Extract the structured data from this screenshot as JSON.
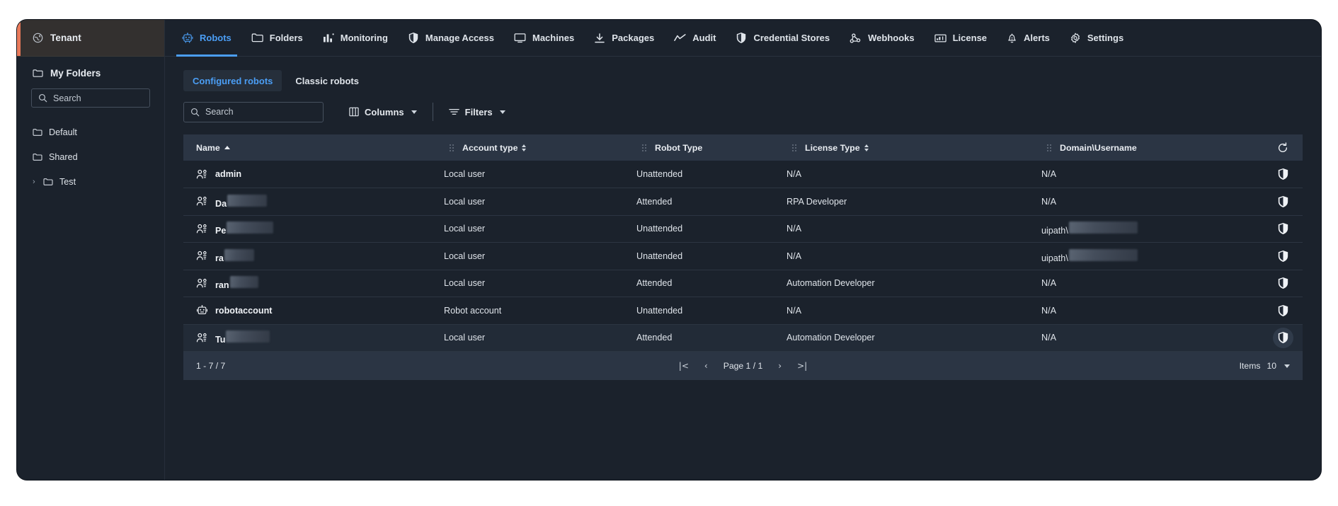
{
  "sidebar": {
    "tenant_label": "Tenant",
    "tenant_icon": "globe-icon",
    "my_folders_label": "My Folders",
    "search_placeholder": "Search",
    "folders": [
      {
        "label": "Default",
        "expandable": false
      },
      {
        "label": "Shared",
        "expandable": false
      },
      {
        "label": "Test",
        "expandable": true
      }
    ]
  },
  "topnav": {
    "tabs": [
      {
        "label": "Robots",
        "icon": "robot-icon",
        "active": true
      },
      {
        "label": "Folders",
        "icon": "folder-icon",
        "active": false
      },
      {
        "label": "Monitoring",
        "icon": "bar-chart-icon",
        "active": false
      },
      {
        "label": "Manage Access",
        "icon": "shield-icon",
        "active": false
      },
      {
        "label": "Machines",
        "icon": "monitor-icon",
        "active": false
      },
      {
        "label": "Packages",
        "icon": "download-icon",
        "active": false
      },
      {
        "label": "Audit",
        "icon": "trend-line-icon",
        "active": false
      },
      {
        "label": "Credential Stores",
        "icon": "shield-icon",
        "active": false
      },
      {
        "label": "Webhooks",
        "icon": "webhook-icon",
        "active": false
      },
      {
        "label": "License",
        "icon": "license-icon",
        "active": false
      },
      {
        "label": "Alerts",
        "icon": "bell-icon",
        "active": false
      },
      {
        "label": "Settings",
        "icon": "gear-icon",
        "active": false
      }
    ]
  },
  "subtabs": [
    {
      "label": "Configured robots",
      "active": true
    },
    {
      "label": "Classic robots",
      "active": false
    }
  ],
  "toolbar": {
    "search_placeholder": "Search",
    "columns_label": "Columns",
    "filters_label": "Filters",
    "columns_icon": "columns-icon",
    "filters_icon": "filter-icon"
  },
  "table": {
    "columns": [
      {
        "label": "Name",
        "sort": "asc",
        "draggable": false
      },
      {
        "label": "Account type",
        "sort": "both",
        "draggable": true
      },
      {
        "label": "Robot Type",
        "sort": "none",
        "draggable": true
      },
      {
        "label": "License Type",
        "sort": "both",
        "draggable": true
      },
      {
        "label": "Domain\\Username",
        "sort": "none",
        "draggable": true
      }
    ],
    "refresh_icon": "refresh-icon",
    "rows": [
      {
        "name": "admin",
        "name_redacted_width": 0,
        "icon": "users-icon",
        "account_type": "Local user",
        "robot_type": "Unattended",
        "license_type": "N/A",
        "domain_username": "N/A",
        "domain_redacted_width": 0,
        "selected": false,
        "shield_icon": "shield-icon"
      },
      {
        "name": "Da",
        "name_redacted_width": 56,
        "icon": "users-icon",
        "account_type": "Local user",
        "robot_type": "Attended",
        "license_type": "RPA Developer",
        "domain_username": "N/A",
        "domain_redacted_width": 0,
        "selected": false,
        "shield_icon": "shield-icon"
      },
      {
        "name": "Pe",
        "name_redacted_width": 66,
        "icon": "users-icon",
        "account_type": "Local user",
        "robot_type": "Unattended",
        "license_type": "N/A",
        "domain_username": "uipath\\",
        "domain_redacted_width": 97,
        "selected": false,
        "shield_icon": "shield-icon"
      },
      {
        "name": "ra",
        "name_redacted_width": 42,
        "icon": "users-icon",
        "account_type": "Local user",
        "robot_type": "Unattended",
        "license_type": "N/A",
        "domain_username": "uipath\\",
        "domain_redacted_width": 97,
        "selected": false,
        "shield_icon": "shield-icon"
      },
      {
        "name": "ran",
        "name_redacted_width": 40,
        "icon": "users-icon",
        "account_type": "Local user",
        "robot_type": "Attended",
        "license_type": "Automation Developer",
        "domain_username": "N/A",
        "domain_redacted_width": 0,
        "selected": false,
        "shield_icon": "shield-icon"
      },
      {
        "name": "robotaccount",
        "name_redacted_width": 0,
        "icon": "robot-icon",
        "account_type": "Robot account",
        "robot_type": "Unattended",
        "license_type": "N/A",
        "domain_username": "N/A",
        "domain_redacted_width": 0,
        "selected": false,
        "shield_icon": "shield-icon"
      },
      {
        "name": "Tu",
        "name_redacted_width": 62,
        "icon": "users-icon",
        "account_type": "Local user",
        "robot_type": "Attended",
        "license_type": "Automation Developer",
        "domain_username": "N/A",
        "domain_redacted_width": 0,
        "selected": true,
        "shield_icon": "shield-icon"
      }
    ]
  },
  "footer": {
    "range": "1 - 7 / 7",
    "first_page": "|<",
    "prev_page": "‹",
    "page_label": "Page 1 / 1",
    "next_page": "›",
    "last_page": ">|",
    "items_label": "Items",
    "items_value": "10"
  },
  "colors": {
    "accent_blue": "#4b9ef5",
    "tenant_accent": "#e8795a",
    "panel_bg": "#1b222c",
    "header_bg": "#2b3544"
  }
}
